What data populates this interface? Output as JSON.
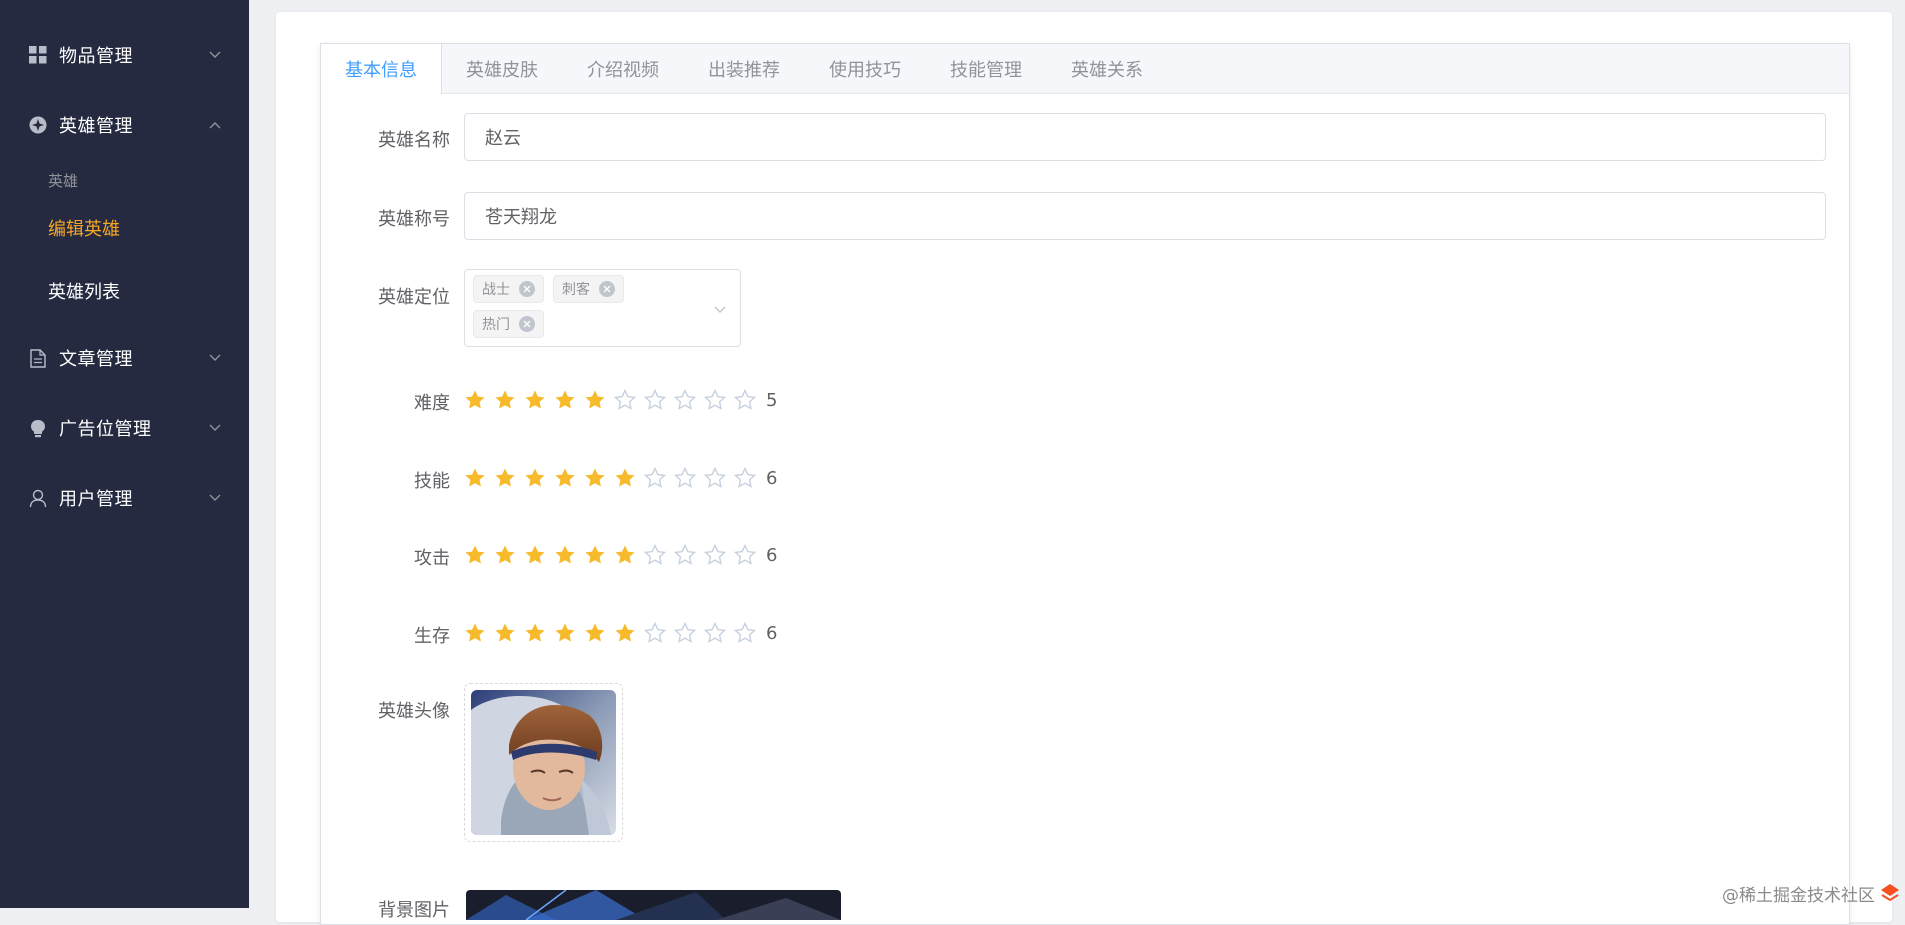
{
  "sidebar": {
    "items": [
      {
        "label": "物品管理",
        "icon": "grid-icon"
      },
      {
        "label": "英雄管理",
        "icon": "hero-icon"
      },
      {
        "label": "文章管理",
        "icon": "document-icon"
      },
      {
        "label": "广告位管理",
        "icon": "bulb-icon"
      },
      {
        "label": "用户管理",
        "icon": "user-icon"
      }
    ],
    "hero_group_title": "英雄",
    "hero_sub": [
      {
        "label": "编辑英雄",
        "active": true
      },
      {
        "label": "英雄列表",
        "active": false
      }
    ]
  },
  "tabs": [
    {
      "label": "基本信息",
      "active": true
    },
    {
      "label": "英雄皮肤"
    },
    {
      "label": "介绍视频"
    },
    {
      "label": "出装推荐"
    },
    {
      "label": "使用技巧"
    },
    {
      "label": "技能管理"
    },
    {
      "label": "英雄关系"
    }
  ],
  "form": {
    "name_label": "英雄名称",
    "name_value": "赵云",
    "title_label": "英雄称号",
    "title_value": "苍天翔龙",
    "position_label": "英雄定位",
    "position_tags": [
      "战士",
      "刺客",
      "热门"
    ],
    "ratings": [
      {
        "label": "难度",
        "value": 5,
        "max": 10
      },
      {
        "label": "技能",
        "value": 6,
        "max": 10
      },
      {
        "label": "攻击",
        "value": 6,
        "max": 10
      },
      {
        "label": "生存",
        "value": 6,
        "max": 10
      }
    ],
    "avatar_label": "英雄头像",
    "background_label": "背景图片"
  },
  "colors": {
    "sidebar_bg": "#252a41",
    "active_menu": "#f5a623",
    "tab_active": "#409eff",
    "star_on": "#f7ba2a",
    "star_off": "#c6d1de"
  },
  "watermark": "@稀土掘金技术社区"
}
